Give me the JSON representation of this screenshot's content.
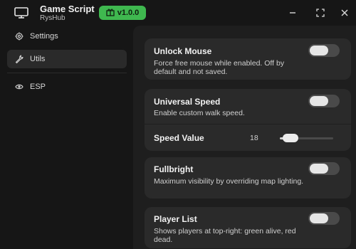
{
  "header": {
    "title": "Game Script",
    "subtitle": "RysHub",
    "version": "v1.0.0",
    "app_icon": "monitor-icon",
    "badge_icon": "gift-icon",
    "badge_color": "#3fb84f",
    "window_controls": [
      "minimize-icon",
      "maximize-icon",
      "close-icon"
    ]
  },
  "sidebar": {
    "items": [
      {
        "label": "Settings",
        "icon": "gear-icon",
        "active": false
      },
      {
        "label": "Utils",
        "icon": "wrench-icon",
        "active": true
      },
      {
        "label": "ESP",
        "icon": "eye-icon",
        "active": false
      }
    ]
  },
  "main": {
    "cards": [
      {
        "title": "Unlock Mouse",
        "description": "Force free mouse while enabled. Off by default and not saved.",
        "enabled": false
      },
      {
        "title": "Universal Speed",
        "description": "Enable custom walk speed.",
        "enabled": false,
        "slider": {
          "label": "Speed Value",
          "value": "18",
          "fraction": 0.12
        }
      },
      {
        "title": "Fullbright",
        "description": "Maximum visibility by overriding map lighting.",
        "enabled": false
      },
      {
        "title": "Player List",
        "description": "Shows players at top-right: green alive, red dead.",
        "enabled": false
      }
    ]
  }
}
